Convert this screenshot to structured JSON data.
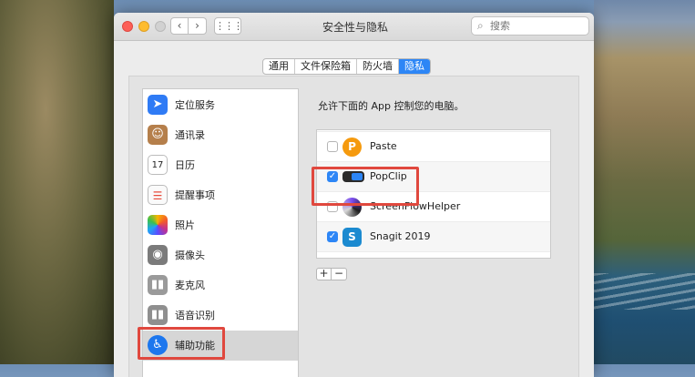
{
  "window": {
    "title": "安全性与隐私",
    "nav_back": "‹",
    "nav_forward": "›",
    "grid": "⋮⋮⋮",
    "search_placeholder": "搜索"
  },
  "tabs": [
    {
      "label": "通用",
      "active": false
    },
    {
      "label": "文件保险箱",
      "active": false
    },
    {
      "label": "防火墙",
      "active": false
    },
    {
      "label": "隐私",
      "active": true
    }
  ],
  "sidebar": {
    "items": [
      {
        "label": "定位服务",
        "icon": "location-arrow-icon",
        "glyph": "➤"
      },
      {
        "label": "通讯录",
        "icon": "contacts-book-icon",
        "glyph": "☺"
      },
      {
        "label": "日历",
        "icon": "calendar-icon",
        "glyph": "17"
      },
      {
        "label": "提醒事项",
        "icon": "reminders-icon",
        "glyph": "☰"
      },
      {
        "label": "照片",
        "icon": "photos-icon",
        "glyph": ""
      },
      {
        "label": "摄像头",
        "icon": "camera-icon",
        "glyph": "◉"
      },
      {
        "label": "麦克风",
        "icon": "microphone-waveform-icon",
        "glyph": "▮▮"
      },
      {
        "label": "语音识别",
        "icon": "speech-waveform-icon",
        "glyph": "▮▮"
      },
      {
        "label": "辅助功能",
        "icon": "accessibility-icon",
        "glyph": "♿",
        "selected": true
      }
    ]
  },
  "main": {
    "label": "允许下面的 App 控制您的电脑。",
    "apps": [
      {
        "name": "Paste",
        "checked": false,
        "icon": "paste-app-icon",
        "glyph": "P"
      },
      {
        "name": "PopClip",
        "checked": true,
        "icon": "popclip-app-icon",
        "glyph": ""
      },
      {
        "name": "ScreenFlowHelper",
        "checked": false,
        "icon": "screenflow-app-icon",
        "glyph": ""
      },
      {
        "name": "Snagit 2019",
        "checked": true,
        "icon": "snagit-app-icon",
        "glyph": "S"
      }
    ],
    "add_label": "+",
    "remove_label": "−",
    "check_mark": "✓"
  },
  "colors": {
    "accent": "#2d86f6",
    "highlight_box": "#e0483e"
  }
}
